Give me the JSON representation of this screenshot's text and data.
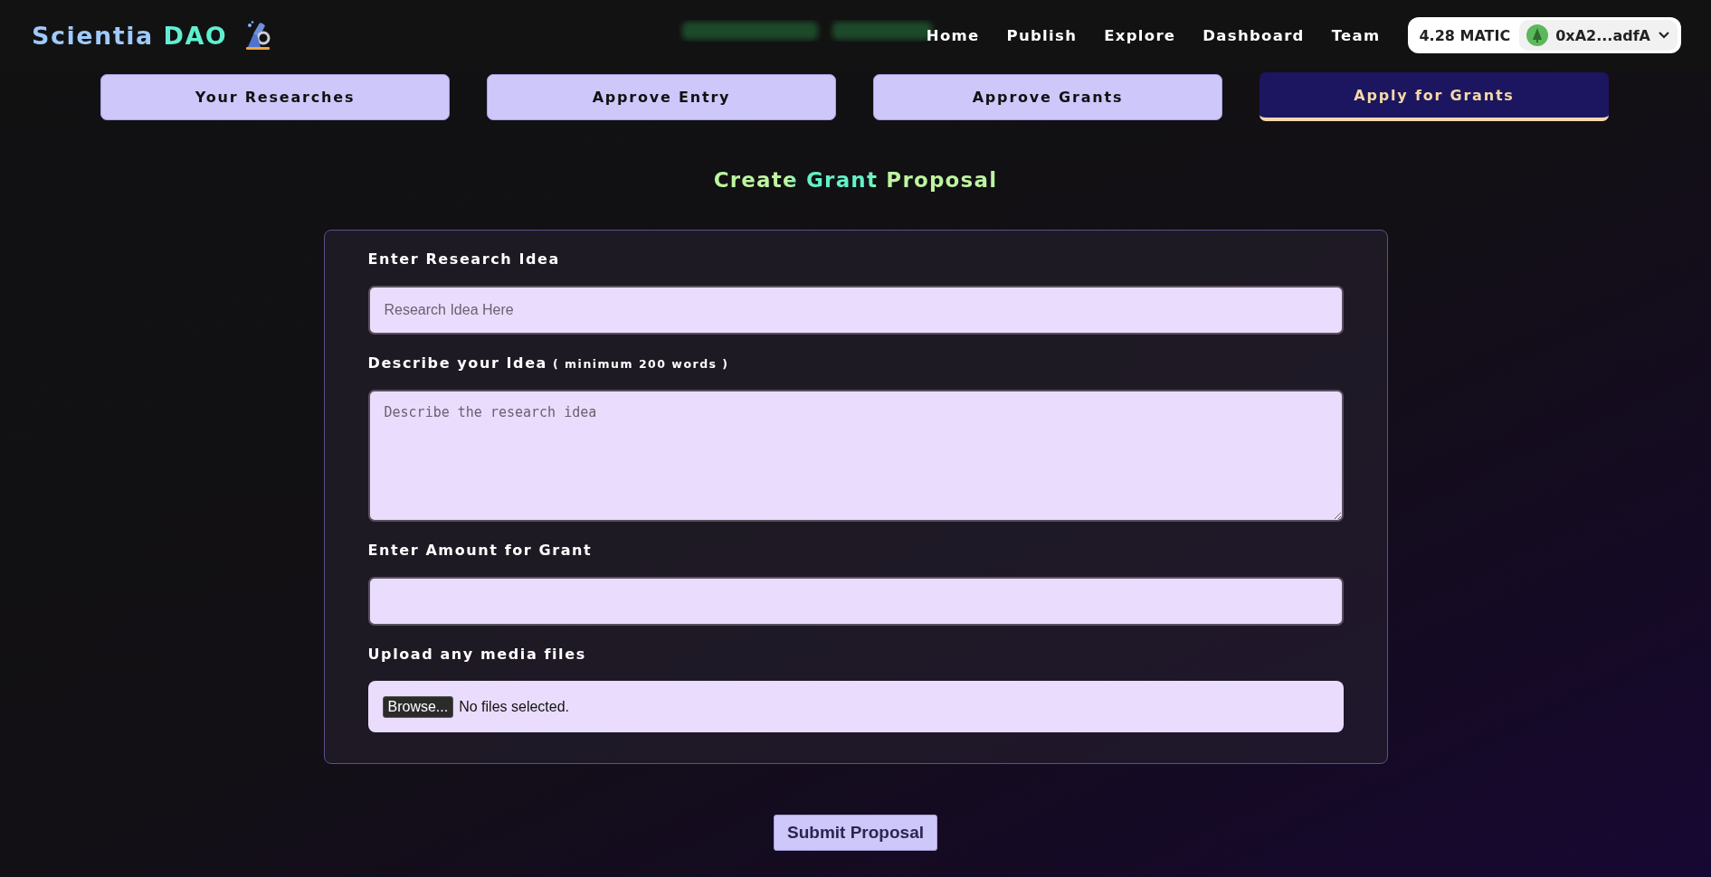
{
  "header": {
    "logo": "Scientia DAO",
    "nav": [
      {
        "label": "Home"
      },
      {
        "label": "Publish"
      },
      {
        "label": "Explore"
      },
      {
        "label": "Dashboard"
      },
      {
        "label": "Team"
      }
    ],
    "wallet": {
      "balance": "4.28 MATIC",
      "address": "0xA2...adfA"
    }
  },
  "tabs": [
    {
      "label": "Your Researches",
      "selected": false
    },
    {
      "label": "Approve Entry",
      "selected": false
    },
    {
      "label": "Approve Grants",
      "selected": false
    },
    {
      "label": "Apply for Grants",
      "selected": true
    }
  ],
  "form": {
    "title": "Create Grant Proposal",
    "fields": [
      {
        "kind": "text",
        "label": "Enter Research Idea",
        "placeholder": "Research Idea Here"
      },
      {
        "kind": "textarea",
        "label": "Describe your Idea",
        "note": "( minimum 200 words )",
        "placeholder": "Describe the research idea"
      },
      {
        "kind": "text",
        "label": "Enter Amount for Grant"
      },
      {
        "kind": "file",
        "label": "Upload any media files",
        "button": "Browse...",
        "status": "No files selected."
      }
    ],
    "submit": "Submit Proposal"
  }
}
